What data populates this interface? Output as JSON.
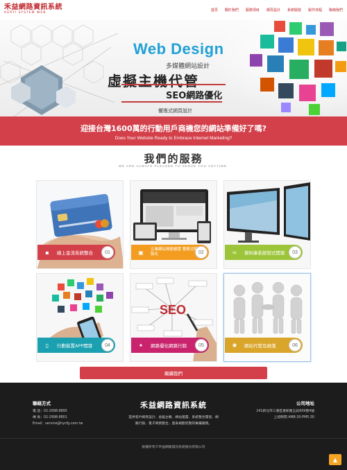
{
  "logo": {
    "cn": "禾益網路資訊系統",
    "en": "HERYI SYSTEM WEB"
  },
  "nav": [
    "首頁",
    "關於我們",
    "服務項目",
    "網頁設計",
    "系統開發",
    "製作流程",
    "聯絡我們"
  ],
  "hero": {
    "title": "Web Design",
    "line1": "多媒體網站設計",
    "line2": "虛擬主機代管",
    "line3": "SEO網路優化",
    "line4": "響應式網頁設計"
  },
  "banner": {
    "cn": "迎接台灣1600萬的行動用戶商機您的網站準備好了嗎?",
    "en": "Does Your Website Ready to Embrace Internet Marketing?"
  },
  "services": {
    "title": "我們的服務",
    "subtitle": "WE ARE ALWAYS PLEASED TO SERVE YOU ANYTIME.",
    "cards": [
      {
        "label": "線上金流系統整合",
        "num": "01",
        "color": "#d3404a",
        "icon": "credit-card-icon"
      },
      {
        "label": "企業網站規劃建置 響應式網頁客製化",
        "num": "02",
        "color": "#f39c1f",
        "icon": "monitor-icon"
      },
      {
        "label": "資料庫系統程式開發",
        "num": "03",
        "color": "#9cc53a",
        "icon": "wifi-icon"
      },
      {
        "label": "行動裝置APP開發",
        "num": "04",
        "color": "#1aa0b0",
        "icon": "mobile-icon"
      },
      {
        "label": "網路優化網路行銷",
        "num": "05",
        "color": "#c8236c",
        "icon": "network-icon"
      },
      {
        "label": "網站代管及維護",
        "num": "06",
        "color": "#d9a52a",
        "icon": "tools-icon"
      }
    ]
  },
  "more_button": "繼續我們",
  "footer": {
    "contact_title": "聯絡方式",
    "contact": [
      "電 話：02-2998-8895",
      "傳 真：02-2998-8801",
      "Email：service@hycfg.com.tw"
    ],
    "center_title": "禾益網路資訊系統",
    "center_desc": [
      "提供客戶網頁設計、虛擬主機、網站建置、系統整合開發、網",
      "路行銷、電子商務整合，量身規劃完整的專屬服務。"
    ],
    "address_title": "公司地址",
    "address": [
      "241新北市三重區重新路五段609巷4號",
      "上班時間 AM8:30-PM5:30"
    ],
    "copyright": "版權所有©禾益網路資訊系統股份有限公司",
    "to_top_icon": "chevron-up-icon"
  }
}
